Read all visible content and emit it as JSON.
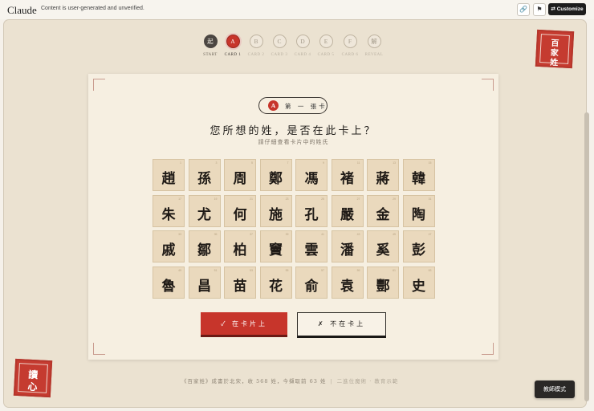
{
  "topbar": {
    "brand": "Claude",
    "notice": "Content is user-generated and unverified.",
    "customize_label": "Customize",
    "link_icon": "link-icon",
    "flag_icon": "flag-icon",
    "customize_icon": "shuffle-icon"
  },
  "stepper": {
    "steps": [
      {
        "glyph": "起",
        "label": "START",
        "state": "done"
      },
      {
        "glyph": "A",
        "label": "CARD 1",
        "state": "active"
      },
      {
        "glyph": "B",
        "label": "CARD 2",
        "state": "pending"
      },
      {
        "glyph": "C",
        "label": "CARD 3",
        "state": "pending"
      },
      {
        "glyph": "D",
        "label": "CARD 4",
        "state": "pending"
      },
      {
        "glyph": "E",
        "label": "CARD 5",
        "state": "pending"
      },
      {
        "glyph": "F",
        "label": "CARD 6",
        "state": "pending"
      },
      {
        "glyph": "解",
        "label": "REVEAL",
        "state": "pending"
      }
    ]
  },
  "seal_top": {
    "line1": "百",
    "line2": "家",
    "line3": "姓"
  },
  "seal_bottom": {
    "line1": "讀",
    "line2": "心"
  },
  "card": {
    "badge_letter": "A",
    "badge_text": "第 一 張卡",
    "question": "您所想的姓，是否在此卡上？",
    "hint": "請仔細查看卡片中的姓氏",
    "surnames": [
      {
        "char": "趙",
        "num": "1"
      },
      {
        "char": "孫",
        "num": "3"
      },
      {
        "char": "周",
        "num": "5"
      },
      {
        "char": "鄭",
        "num": "7"
      },
      {
        "char": "馮",
        "num": "9"
      },
      {
        "char": "褚",
        "num": "11"
      },
      {
        "char": "蔣",
        "num": "13"
      },
      {
        "char": "韓",
        "num": "15"
      },
      {
        "char": "朱",
        "num": "17"
      },
      {
        "char": "尤",
        "num": "19"
      },
      {
        "char": "何",
        "num": "21"
      },
      {
        "char": "施",
        "num": "23"
      },
      {
        "char": "孔",
        "num": "25"
      },
      {
        "char": "嚴",
        "num": "27"
      },
      {
        "char": "金",
        "num": "29"
      },
      {
        "char": "陶",
        "num": "31"
      },
      {
        "char": "戚",
        "num": "33"
      },
      {
        "char": "鄒",
        "num": "35"
      },
      {
        "char": "柏",
        "num": "37"
      },
      {
        "char": "竇",
        "num": "39"
      },
      {
        "char": "雲",
        "num": "41"
      },
      {
        "char": "潘",
        "num": "43"
      },
      {
        "char": "奚",
        "num": "45"
      },
      {
        "char": "彭",
        "num": "47"
      },
      {
        "char": "魯",
        "num": "49"
      },
      {
        "char": "昌",
        "num": "51"
      },
      {
        "char": "苗",
        "num": "53"
      },
      {
        "char": "花",
        "num": "55"
      },
      {
        "char": "俞",
        "num": "57"
      },
      {
        "char": "袁",
        "num": "59"
      },
      {
        "char": "酆",
        "num": "61"
      },
      {
        "char": "史",
        "num": "63"
      }
    ],
    "yes_label": "✓ 在卡片上",
    "no_label": "✗ 不在卡上"
  },
  "footer": {
    "main": "《百家姓》成書於北宋，收 568 姓，今擷取前 63 姓",
    "separator": "|",
    "muted": "二進位魔術 · 教育示範"
  },
  "teacher_mode_label": "教師模式",
  "colors": {
    "accent": "#c7352b",
    "dark": "#2a2826",
    "card": "#f6efe1",
    "tile": "#ead9bd"
  }
}
